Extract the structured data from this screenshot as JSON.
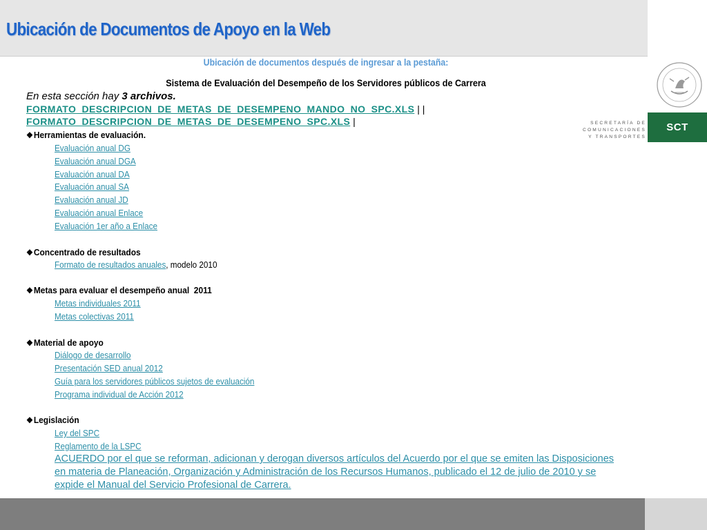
{
  "header": {
    "title": "Ubicación de Documentos de Apoyo en la Web"
  },
  "branding": {
    "ministry_lines": [
      "SECRETARÍA DE",
      "COMUNICACIONES",
      "Y TRANSPORTES"
    ],
    "sct_label": "SCT",
    "seal_text": "ESTADOS UNIDOS MEXICANOS",
    "green": "#1e6e3f"
  },
  "content": {
    "subtitle": "Ubicación de documentos después de ingresar a la pestaña:",
    "section_title": "Sistema de Evaluación del Desempeño de los Servidores públicos de Carrera",
    "intro_prefix": "En esta sección hay ",
    "intro_bold": "3 archivos.",
    "xls_files": [
      {
        "label": "FORMATO_DESCRIPCION_DE_METAS_DE_DESEMPENO_MANDO_NO_SPC.XLS",
        "sep": " | |"
      },
      {
        "label": "FORMATO_DESCRIPCION_DE_METAS_DE_DESEMPENO_SPC.XLS",
        "sep": " |"
      }
    ],
    "groups": [
      {
        "heading": "Herramientas de evaluación.",
        "items": [
          {
            "link": "Evaluación anual DG"
          },
          {
            "link": "Evaluación anual DGA"
          },
          {
            "link": "Evaluación anual DA"
          },
          {
            "link": "Evaluación anual SA"
          },
          {
            "link": "Evaluación anual JD"
          },
          {
            "link": "Evaluación anual Enlace"
          },
          {
            "link": "Evaluación 1er año a Enlace"
          }
        ]
      },
      {
        "heading": "Concentrado de resultados",
        "items": [
          {
            "link": "Formato de resultados anuales",
            "suffix": ", modelo 2010"
          }
        ]
      },
      {
        "heading": "Metas para evaluar el desempeño anual  2011",
        "items": [
          {
            "link": "Metas individuales 2011"
          },
          {
            "link": "Metas colectivas 2011"
          }
        ]
      },
      {
        "heading": "Material de apoyo",
        "items": [
          {
            "link": "Diálogo de desarrollo"
          },
          {
            "link": "Presentación SED anual 2012"
          },
          {
            "link": "Guía para los servidores públicos sujetos de evaluación"
          },
          {
            "link": "Programa individual de Acción 2012"
          }
        ]
      },
      {
        "heading": "Legislación",
        "items": [
          {
            "link": "Ley del SPC"
          },
          {
            "link": "Reglamento de la LSPC"
          }
        ],
        "long_link": "ACUERDO por el que se reforman, adicionan y derogan diversos artículos del Acuerdo por el que se emiten las Disposiciones en materia de Planeación, Organización y Administración de los Recursos Humanos, publicado el 12 de julio de 2010 y se expide el Manual del Servicio Profesional de Carrera."
      }
    ]
  }
}
